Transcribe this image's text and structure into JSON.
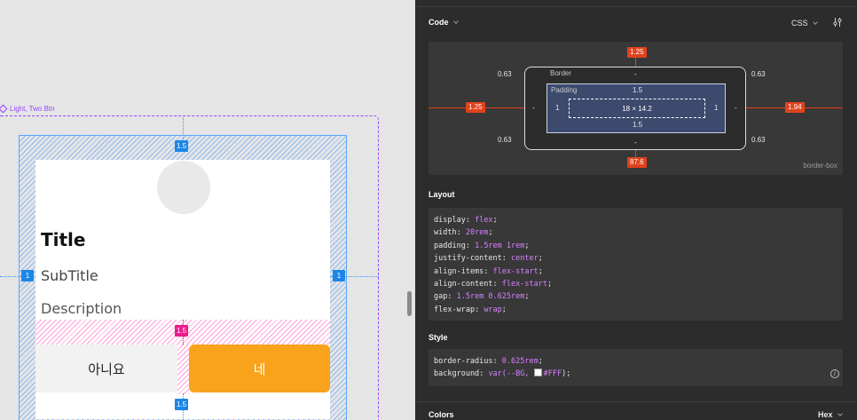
{
  "canvas": {
    "frame_label": "Light, Two Btn",
    "card": {
      "title": "Title",
      "subtitle": "SubTitle",
      "description": "Description",
      "button_no": "아니요",
      "button_yes": "네"
    },
    "badges": {
      "top_padding": "1.5",
      "left_padding": "1",
      "right_padding": "1",
      "gap": "1.5",
      "bottom_padding": "1.5"
    },
    "colors": {
      "selection": "#9747ff",
      "padding": "#1c87e6",
      "gap": "#ec1a8c",
      "primary_button": "#f9a21b"
    }
  },
  "panel": {
    "code_header": "Code",
    "language": "CSS",
    "box_model": {
      "margin_top": "1.25",
      "margin_left": "1.25",
      "margin_right": "1.94",
      "margin_bottom": "87.6",
      "border_label": "Border",
      "border_top": "-",
      "border_left": "-",
      "border_right": "-",
      "border_bottom": "-",
      "radius_tl": "0.63",
      "radius_tr": "0.63",
      "radius_bl": "0.63",
      "radius_br": "0.63",
      "padding_label": "Padding",
      "padding_top": "1.5",
      "padding_left": "1",
      "padding_right": "1",
      "padding_bottom": "1.5",
      "content_size": "18 × 14.2",
      "box_sizing": "border-box"
    },
    "layout_header": "Layout",
    "layout_code": [
      {
        "prop": "display",
        "val": "flex"
      },
      {
        "prop": "width",
        "val": "20rem"
      },
      {
        "prop": "padding",
        "val": "1.5rem 1rem"
      },
      {
        "prop": "justify-content",
        "val": "center"
      },
      {
        "prop": "align-items",
        "val": "flex-start"
      },
      {
        "prop": "align-content",
        "val": "flex-start"
      },
      {
        "prop": "gap",
        "val": "1.5rem 0.625rem"
      },
      {
        "prop": "flex-wrap",
        "val": "wrap"
      }
    ],
    "style_header": "Style",
    "style_code": [
      {
        "prop": "border-radius",
        "val": "0.625rem"
      },
      {
        "prop": "background",
        "val_pre": "var(--BG, ",
        "val_color": "#FFF",
        "val_post": ");"
      }
    ],
    "colors_header": "Colors",
    "color_format": "Hex"
  }
}
